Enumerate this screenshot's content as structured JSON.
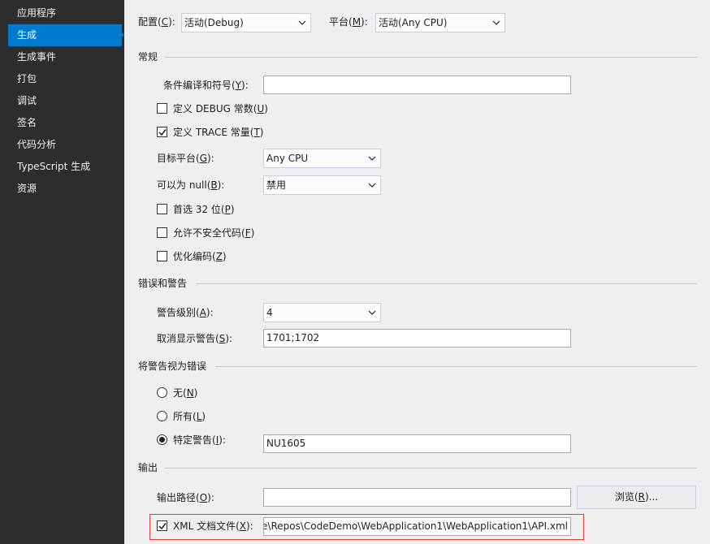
{
  "sidebar": {
    "items": [
      {
        "label": "应用程序",
        "active": false
      },
      {
        "label": "生成",
        "active": true
      },
      {
        "label": "生成事件",
        "active": false
      },
      {
        "label": "打包",
        "active": false
      },
      {
        "label": "调试",
        "active": false
      },
      {
        "label": "签名",
        "active": false
      },
      {
        "label": "代码分析",
        "active": false
      },
      {
        "label": "TypeScript 生成",
        "active": false
      },
      {
        "label": "资源",
        "active": false
      }
    ]
  },
  "top": {
    "config_label": "配置(",
    "config_key": "C",
    "config_suffix": "):",
    "config_value": "活动(Debug)",
    "platform_label": "平台(",
    "platform_key": "M",
    "platform_suffix": "):",
    "platform_value": "活动(Any CPU)"
  },
  "general": {
    "title": "常规",
    "symbols_label": "条件编译和符号(",
    "symbols_key": "Y",
    "symbols_suffix": "):",
    "symbols_value": "",
    "define_debug_label": "定义 DEBUG 常数(",
    "define_debug_key": "U",
    "define_debug_suffix": ")",
    "define_debug_checked": false,
    "define_trace_label": "定义 TRACE 常量(",
    "define_trace_key": "T",
    "define_trace_suffix": ")",
    "define_trace_checked": true,
    "target_label": "目标平台(",
    "target_key": "G",
    "target_suffix": "):",
    "target_value": "Any CPU",
    "nullable_label": "可以为 null(",
    "nullable_key": "B",
    "nullable_suffix": "):",
    "nullable_value": "禁用",
    "prefer32_label": "首选 32 位(",
    "prefer32_key": "P",
    "prefer32_suffix": ")",
    "prefer32_checked": false,
    "unsafe_label": "允许不安全代码(",
    "unsafe_key": "F",
    "unsafe_suffix": ")",
    "unsafe_checked": false,
    "optimize_label": "优化编码(",
    "optimize_key": "Z",
    "optimize_suffix": ")",
    "optimize_checked": false
  },
  "errors": {
    "title": "错误和警告",
    "level_label": "警告级别(",
    "level_key": "A",
    "level_suffix": "):",
    "level_value": "4",
    "suppress_label": "取消显示警告(",
    "suppress_key": "S",
    "suppress_suffix": "):",
    "suppress_value": "1701;1702"
  },
  "treat": {
    "title": "将警告视为错误",
    "none_label": "无(",
    "none_key": "N",
    "none_suffix": ")",
    "all_label": "所有(",
    "all_key": "L",
    "all_suffix": ")",
    "specific_label": "特定警告(",
    "specific_key": "I",
    "specific_suffix": "):",
    "specific_value": "NU1605",
    "selected": "specific"
  },
  "output": {
    "title": "输出",
    "path_label": "输出路径(",
    "path_key": "O",
    "path_suffix": "):",
    "path_value": "",
    "browse_label": "浏览(",
    "browse_key": "R",
    "browse_suffix": ")...",
    "xml_label": "XML 文档文件(",
    "xml_key": "X",
    "xml_suffix": "):",
    "xml_checked": true,
    "xml_value": "e\\Repos\\CodeDemo\\WebApplication1\\WebApplication1\\API.xml"
  },
  "colors": {
    "sidebar_bg": "#2d2d30",
    "accent": "#007acc",
    "highlight": "#e53935"
  }
}
